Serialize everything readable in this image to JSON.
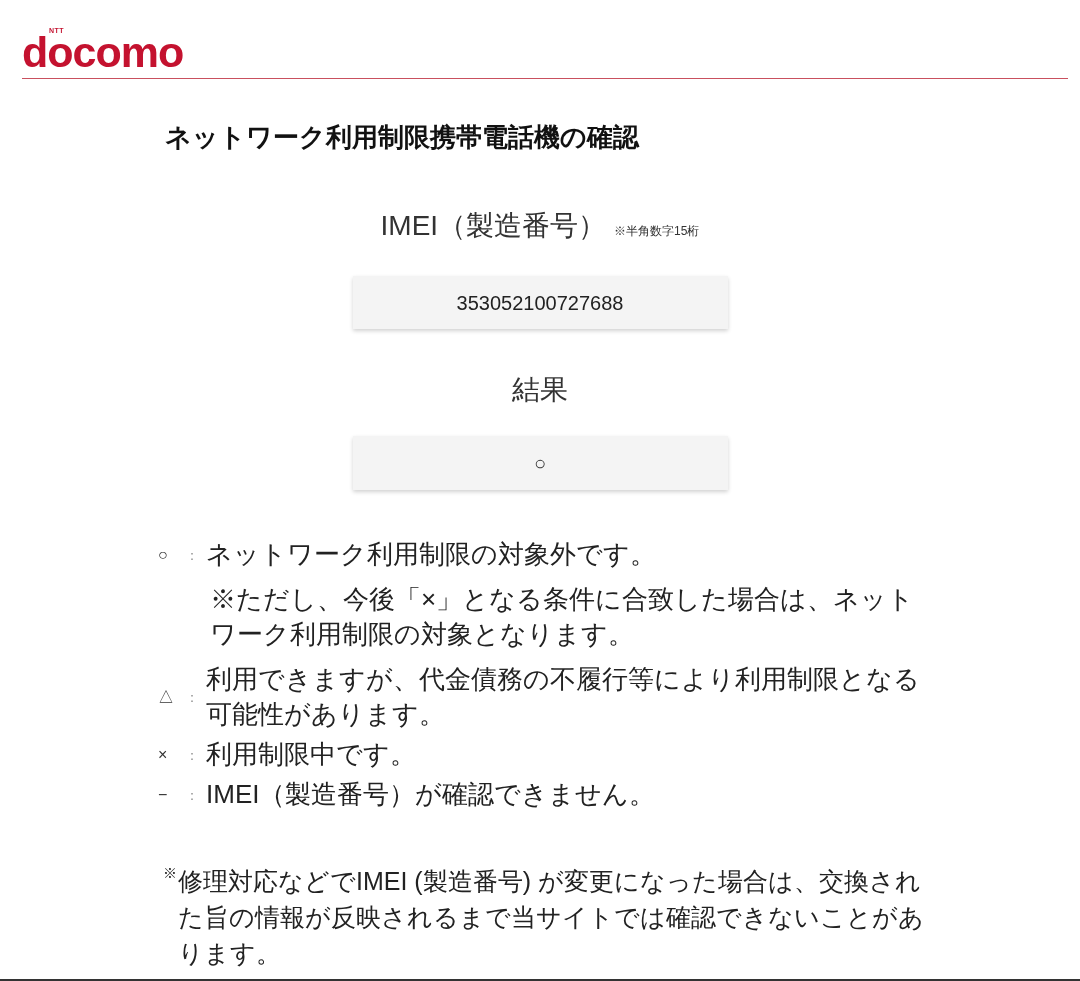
{
  "header": {
    "logo": {
      "tag": "NTT",
      "text": "docomo"
    }
  },
  "page_title": "ネットワーク利用制限携帯電話機の確認",
  "imei": {
    "label": "IMEI（製造番号）",
    "note": "※半角数字15桁",
    "value": "353052100727688"
  },
  "result": {
    "label": "結果",
    "value": "○"
  },
  "legend": [
    {
      "symbol": "○",
      "separator": "：",
      "text": "ネットワーク利用制限の対象外です。",
      "note": "※ただし、今後「×」となる条件に合致した場合は、ネットワーク利用制限の対象となります。"
    },
    {
      "symbol": "△",
      "separator": "：",
      "text": "利用できますが、代金債務の不履行等により利用制限となる可能性があります。"
    },
    {
      "symbol": "×",
      "separator": "：",
      "text": "利用制限中です。"
    },
    {
      "symbol": "−",
      "separator": "：",
      "text": "IMEI（製造番号）が確認できません。"
    }
  ],
  "footnote": {
    "mark": "※",
    "text": "修理対応などでIMEI (製造番号) が変更になった場合は、交換された旨の情報が反映されるまで当サイトでは確認できないことがあります。"
  }
}
